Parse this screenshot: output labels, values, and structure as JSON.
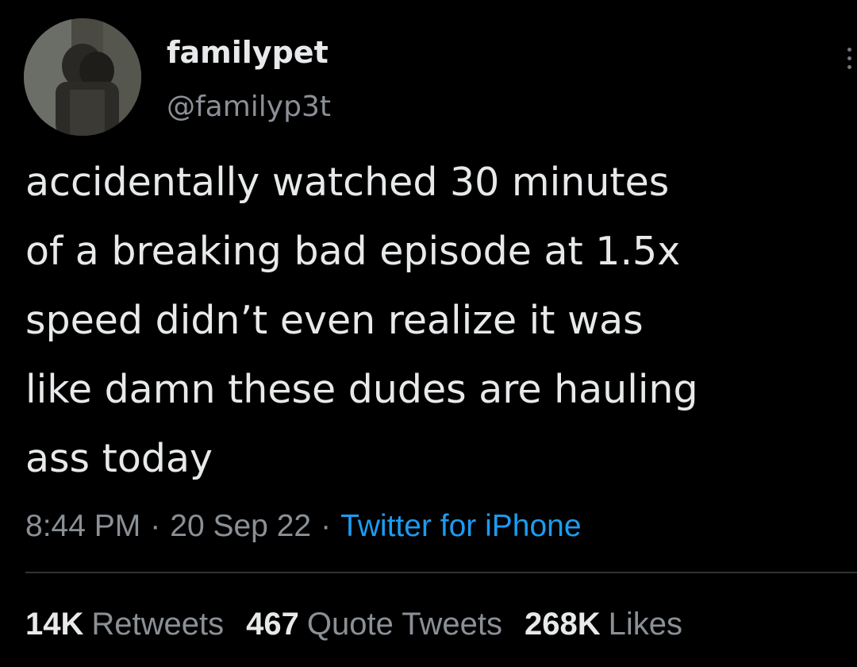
{
  "tweet": {
    "user": {
      "display_name": "familypet",
      "handle": "@familyp3t",
      "avatar_icon": "profile-photo"
    },
    "text_lines": [
      "accidentally watched 30 minutes",
      "of a breaking bad episode at 1.5x",
      "speed didn’t even realize it was",
      "like damn these dudes are hauling",
      "ass today"
    ],
    "meta": {
      "time": "8:44 PM",
      "date": "20 Sep 22",
      "separator": "·",
      "source": "Twitter for iPhone"
    },
    "stats": {
      "retweets": {
        "count": "14K",
        "label": "Retweets"
      },
      "quote_tweets": {
        "count": "467",
        "label": "Quote Tweets"
      },
      "likes": {
        "count": "268K",
        "label": "Likes"
      }
    }
  },
  "colors": {
    "background": "#000000",
    "text": "#e7e9ea",
    "secondary": "#8b9096",
    "link": "#1d9bf0",
    "divider": "#2f3336"
  }
}
